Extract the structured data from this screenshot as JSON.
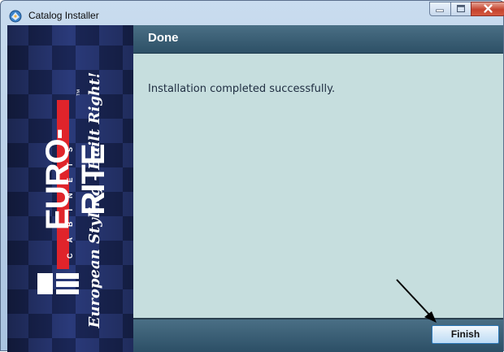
{
  "window": {
    "title": "Catalog Installer",
    "icon": "catalog-installer-icon",
    "controls": [
      "minimize-icon",
      "maximize-icon",
      "close-icon"
    ]
  },
  "banner": {
    "brand": "EURO-RITE",
    "subbrand": "CABINETS",
    "trademark": "™",
    "tagline": "European Styling - Built Right!",
    "colors": {
      "navy": "#1d2a5a",
      "red": "#e0242b"
    }
  },
  "header": {
    "title": "Done"
  },
  "content": {
    "message": "Installation completed successfully."
  },
  "footer": {
    "finish_label": "Finish"
  }
}
